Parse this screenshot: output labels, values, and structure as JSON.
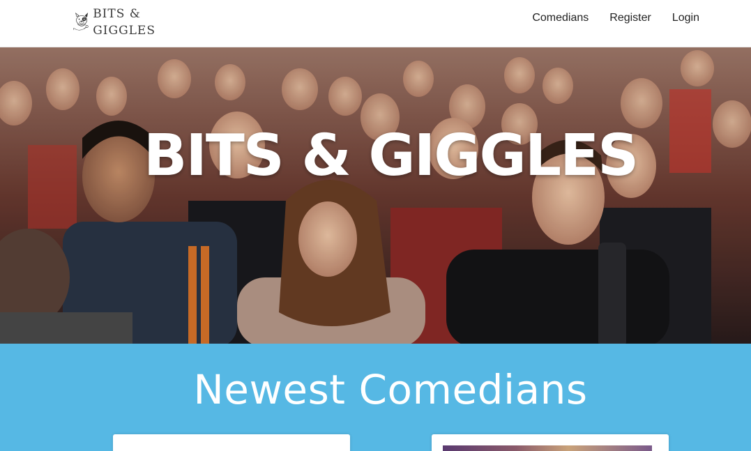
{
  "brand": {
    "line1": "BITS &",
    "line2": "GIGGLES",
    "logo_icon": "bulldog-microphone-icon"
  },
  "nav": {
    "items": [
      {
        "label": "Comedians"
      },
      {
        "label": "Register"
      },
      {
        "label": "Login"
      }
    ]
  },
  "hero": {
    "title": "BITS & GIGGLES",
    "image": "audience-photo"
  },
  "newest": {
    "title": "Newest Comedians",
    "background": "#56b8e4"
  }
}
